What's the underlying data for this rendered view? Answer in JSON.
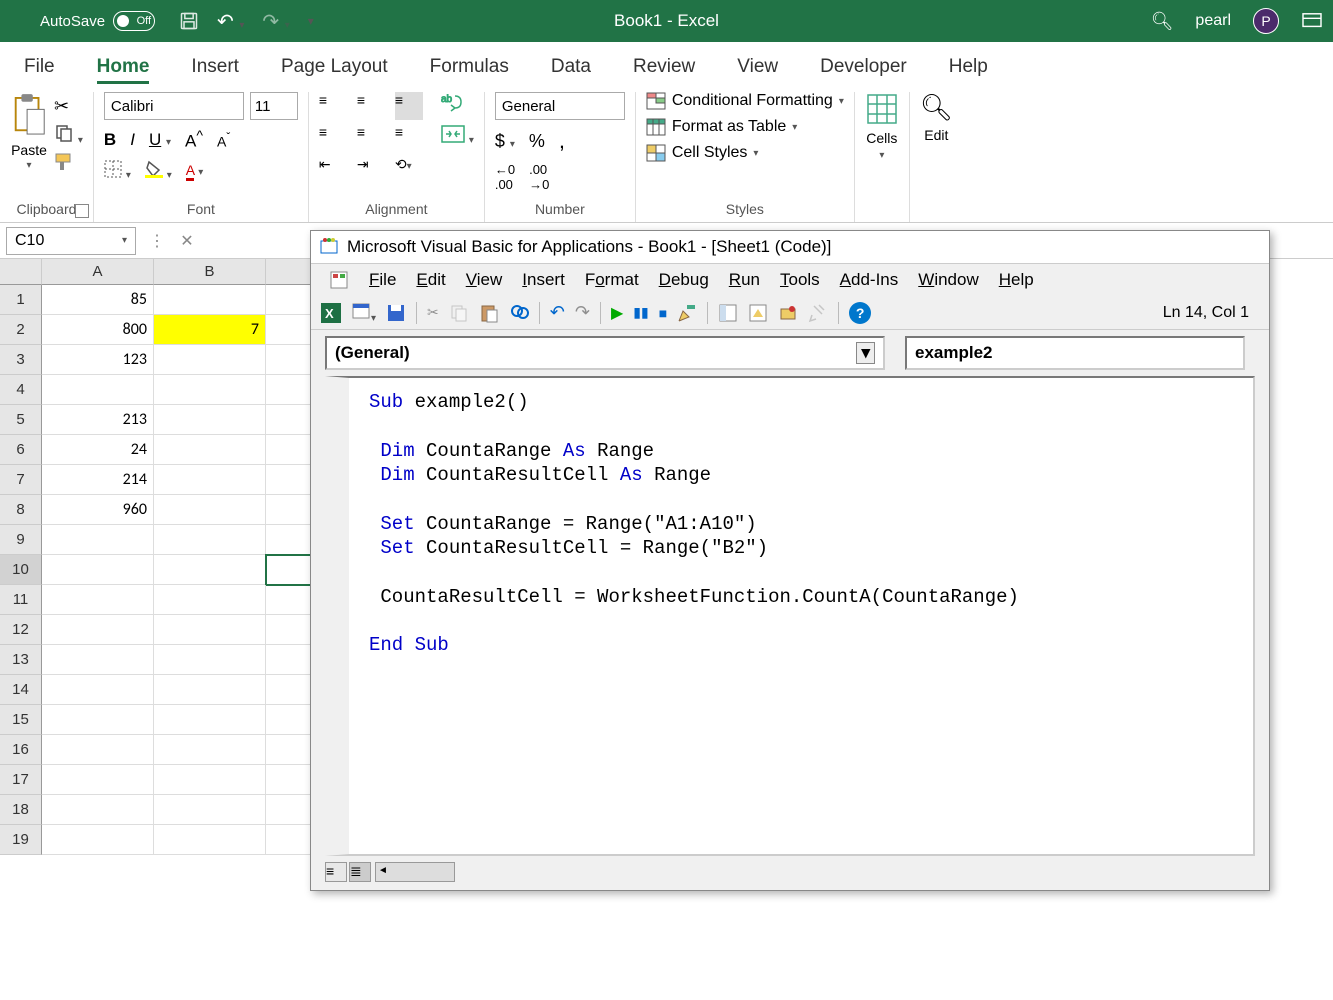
{
  "titlebar": {
    "autosave_label": "AutoSave",
    "autosave_state": "Off",
    "title": "Book1 - Excel",
    "user": "pearl",
    "avatar": "P"
  },
  "tabs": [
    "File",
    "Home",
    "Insert",
    "Page Layout",
    "Formulas",
    "Data",
    "Review",
    "View",
    "Developer",
    "Help"
  ],
  "active_tab": "Home",
  "ribbon": {
    "clipboard": {
      "paste": "Paste",
      "label": "Clipboard"
    },
    "font": {
      "name": "Calibri",
      "size": "11",
      "label": "Font"
    },
    "number": {
      "format": "General",
      "label": "Number"
    },
    "styles": {
      "conditional": "Conditional Formatting",
      "table": "Format as Table",
      "cell": "Cell Styles",
      "label": "Styles"
    },
    "cells": {
      "label": "Cells"
    },
    "edit": {
      "label": "Edit"
    },
    "alignment": {
      "label": "Alignment"
    }
  },
  "name_box": "C10",
  "columns": [
    "A",
    "B"
  ],
  "rows": [
    {
      "n": 1,
      "A": "85",
      "B": ""
    },
    {
      "n": 2,
      "A": "800",
      "B": "7"
    },
    {
      "n": 3,
      "A": "123",
      "B": ""
    },
    {
      "n": 4,
      "A": "",
      "B": ""
    },
    {
      "n": 5,
      "A": "213",
      "B": ""
    },
    {
      "n": 6,
      "A": "24",
      "B": ""
    },
    {
      "n": 7,
      "A": "214",
      "B": ""
    },
    {
      "n": 8,
      "A": "960",
      "B": ""
    },
    {
      "n": 9,
      "A": "",
      "B": ""
    },
    {
      "n": 10,
      "A": "",
      "B": ""
    },
    {
      "n": 11,
      "A": "",
      "B": ""
    },
    {
      "n": 12,
      "A": "",
      "B": ""
    },
    {
      "n": 13,
      "A": "",
      "B": ""
    },
    {
      "n": 14,
      "A": "",
      "B": ""
    },
    {
      "n": 15,
      "A": "",
      "B": ""
    },
    {
      "n": 16,
      "A": "",
      "B": ""
    },
    {
      "n": 17,
      "A": "",
      "B": ""
    },
    {
      "n": 18,
      "A": "",
      "B": ""
    },
    {
      "n": 19,
      "A": "",
      "B": ""
    }
  ],
  "highlight_cell": "B2",
  "selected_cell": "C10",
  "vba": {
    "title": "Microsoft Visual Basic for Applications - Book1 - [Sheet1 (Code)]",
    "menu": [
      "File",
      "Edit",
      "View",
      "Insert",
      "Format",
      "Debug",
      "Run",
      "Tools",
      "Add-Ins",
      "Window",
      "Help"
    ],
    "position": "Ln 14, Col 1",
    "dd_object": "(General)",
    "dd_proc": "example2",
    "code_lines": [
      {
        "t": "Sub example2()",
        "kw": [
          "Sub"
        ]
      },
      {
        "t": ""
      },
      {
        "t": " Dim CountaRange As Range",
        "kw": [
          "Dim",
          "As"
        ]
      },
      {
        "t": " Dim CountaResultCell As Range",
        "kw": [
          "Dim",
          "As"
        ]
      },
      {
        "t": ""
      },
      {
        "t": " Set CountaRange = Range(\"A1:A10\")",
        "kw": [
          "Set"
        ]
      },
      {
        "t": " Set CountaResultCell = Range(\"B2\")",
        "kw": [
          "Set"
        ]
      },
      {
        "t": ""
      },
      {
        "t": " CountaResultCell = WorksheetFunction.CountA(CountaRange)",
        "kw": []
      },
      {
        "t": ""
      },
      {
        "t": "End Sub",
        "kw": [
          "End",
          "Sub"
        ]
      }
    ]
  }
}
